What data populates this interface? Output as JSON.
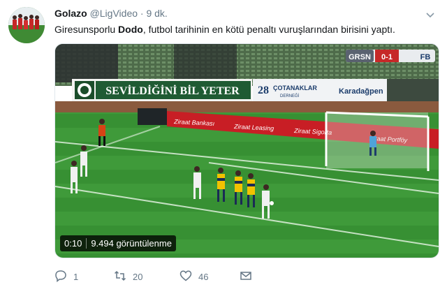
{
  "tweet": {
    "author_name": "Golazo",
    "handle": "@LigVideo",
    "separator": "·",
    "time": "9 dk.",
    "text_before": "Giresunsporlu ",
    "text_bold": "Dodo",
    "text_after": ", futbol tarihinin en kötü penaltı vuruşlarından birisini yaptı."
  },
  "media": {
    "duration": "0:10",
    "views": "9.494 görüntülenme",
    "scoreboard_home": "GRSN",
    "scoreboard_score": "0-1",
    "scoreboard_away": "FB",
    "banner_main": "SEVİLDİĞİNİ BİL YETER",
    "banner_28": "28",
    "banner_org": "ÇOTANAKLAR",
    "banner_org_sub": "DERNEĞİ",
    "banner_sponsor": "Karadağpen",
    "ad_text_1": "Ziraat Bankası",
    "ad_text_2": "Ziraat Leasing",
    "ad_text_3": "Ziraat Sigorta",
    "ad_text_4": "Ziraat Portföy"
  },
  "actions": {
    "reply_count": "1",
    "retweet_count": "20",
    "like_count": "46"
  },
  "icons": [
    "caret-down-icon",
    "reply-icon",
    "retweet-icon",
    "like-icon",
    "message-icon"
  ]
}
